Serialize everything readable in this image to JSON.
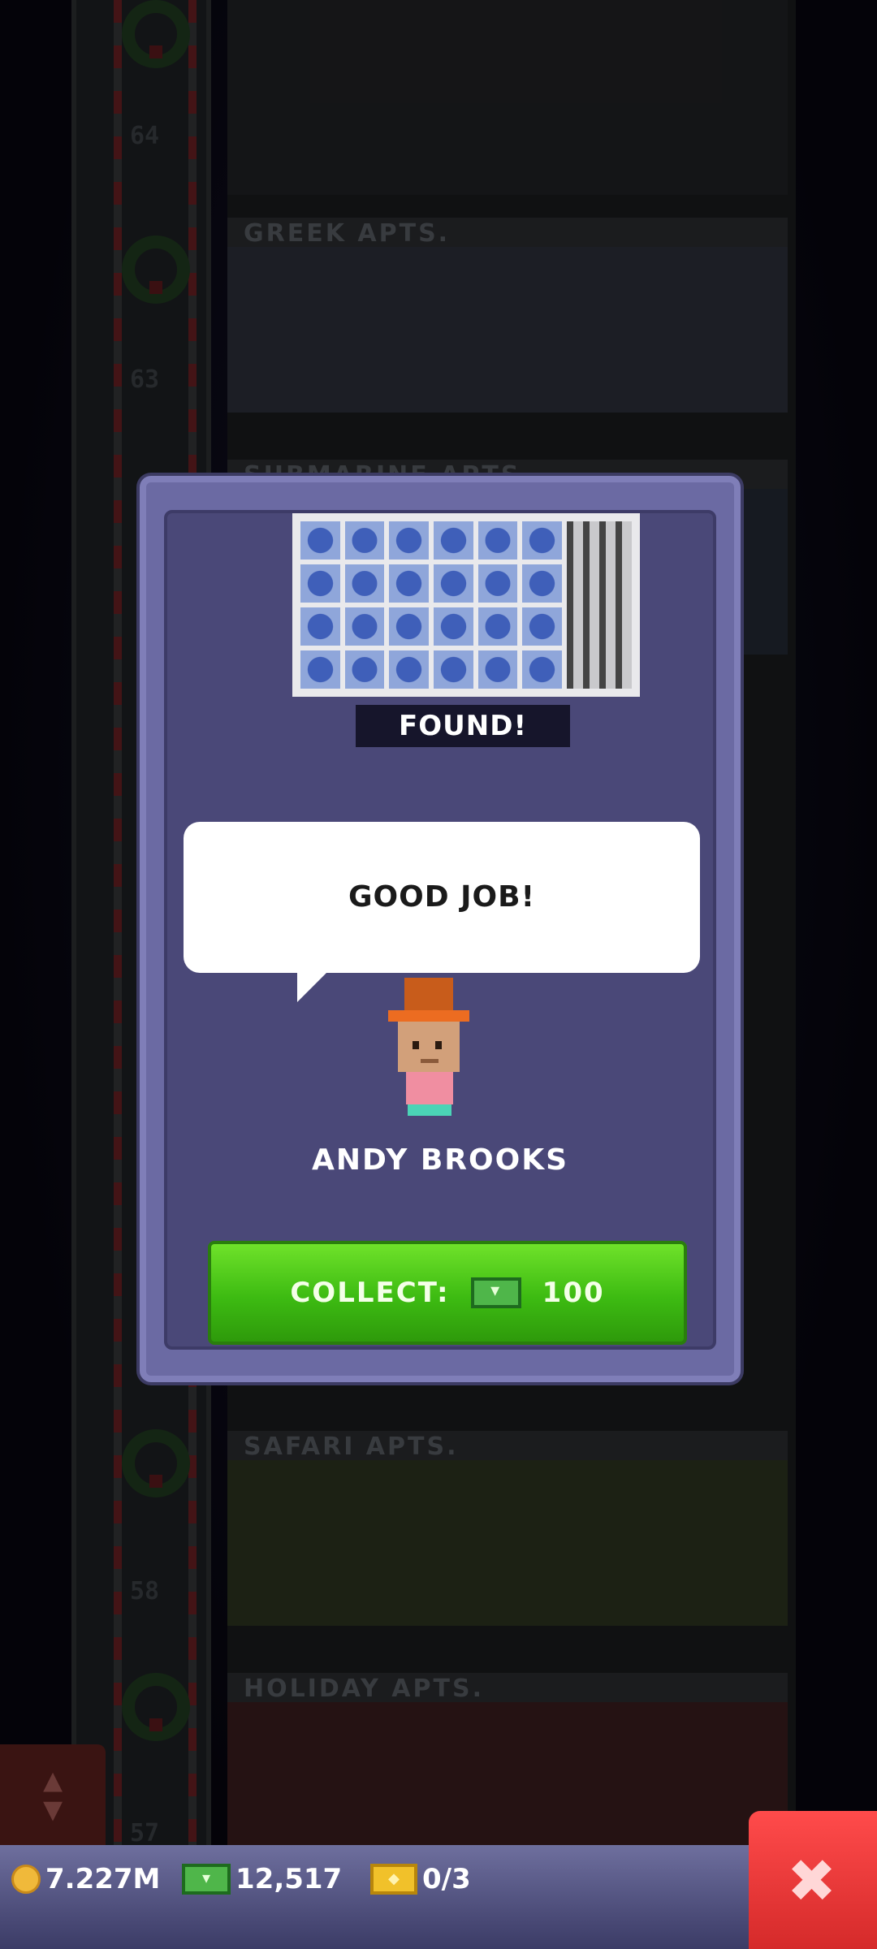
{
  "background": {
    "floor_numbers": [
      "64",
      "63",
      "58",
      "57"
    ],
    "floor_labels": [
      "GREEK APTS.",
      "SUBMARINE APTS.",
      "SAFARI APTS.",
      "HOLIDAY APTS."
    ]
  },
  "dialog": {
    "status_badge": "FOUND!",
    "speech_text": "GOOD JOB!",
    "character_name": "ANDY BROOKS",
    "collect_label": "COLLECT:",
    "collect_amount": "100",
    "collect_icon": "bux-icon"
  },
  "hud": {
    "coins": "7.227M",
    "bux": "12,517",
    "tickets": "0/3",
    "close_icon": "close-icon",
    "elevator_icon": "elevator-updown-icon"
  },
  "colors": {
    "dialog_bg": "#4a4878",
    "collect_button": "#3dbb12",
    "close_button": "#e03030"
  }
}
